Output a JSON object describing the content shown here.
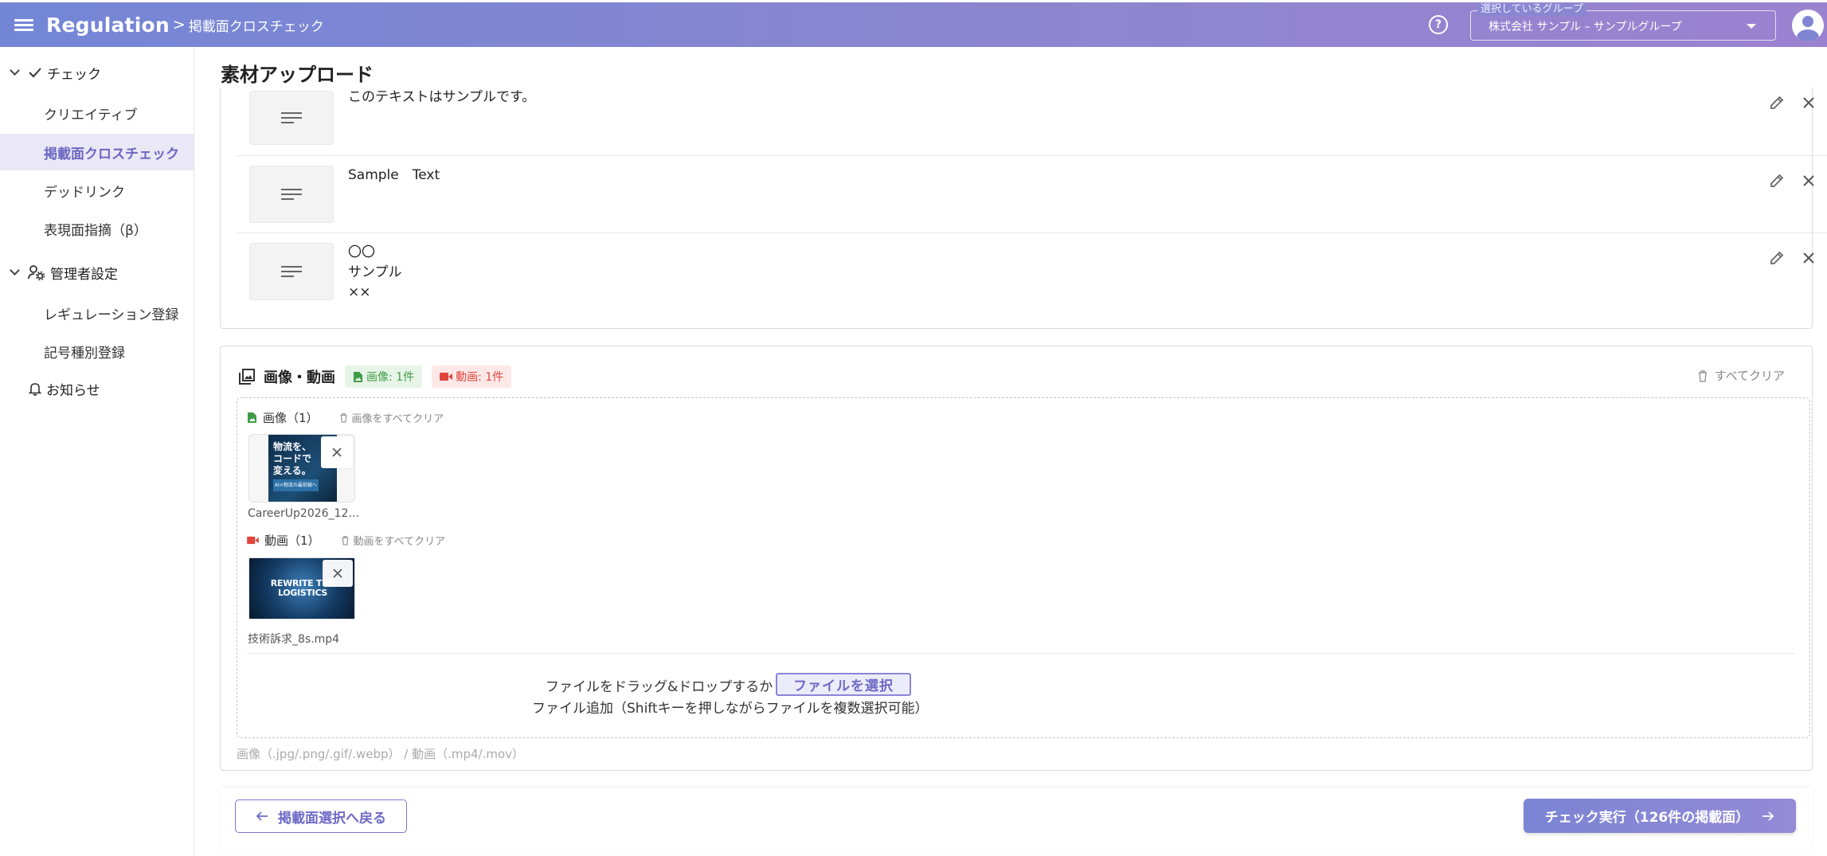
{
  "header": {
    "brand": "Regulation",
    "crumb_sep": ">",
    "crumb": "掲載面クロスチェック",
    "help_glyph": "?",
    "group_legend": "選択しているグループ",
    "group_value": "株式会社 サンプル – サンプルグループ"
  },
  "sidebar": {
    "check_group": "チェック",
    "check_items": [
      "クリエイティブ",
      "掲載面クロスチェック",
      "デッドリンク",
      "表現面指摘（β）"
    ],
    "active_item": "掲載面クロスチェック",
    "admin_group": "管理者設定",
    "admin_items": [
      "レギュレーション登録",
      "記号種別登録"
    ],
    "notice": "お知らせ"
  },
  "main": {
    "title": "素材アップロード",
    "text_rows": [
      {
        "text": "このテキストはサンプルです。"
      },
      {
        "text": "Sample　Text"
      },
      {
        "text": "〇〇\nサンプル\n××"
      }
    ],
    "media": {
      "title": "画像・動画",
      "image_badge": "画像: 1件",
      "video_badge": "動画: 1件",
      "clear_all": "すべてクリア",
      "image_head": "画像（1）",
      "image_clear": "画像をすべてクリア",
      "image_thumb_lines": [
        "物流を、",
        "コードで",
        "変える。"
      ],
      "image_thumb_sub": "AI×物流の最前線へ",
      "image_caption": "CareerUp2026_12…",
      "video_head": "動画（1）",
      "video_clear": "動画をすべてクリア",
      "video_thumb_lines": [
        "REWRITE THE",
        "LOGISTICS"
      ],
      "video_caption": "技術訴求_8s.mp4",
      "drop_text": "ファイルをドラッグ&ドロップするか",
      "choose_button": "ファイルを選択",
      "drop_text2": "ファイル追加（Shiftキーを押しながらファイルを複数選択可能）",
      "formats": "画像（.jpg/.png/.gif/.webp） / 動画（.mp4/.mov）"
    }
  },
  "footer": {
    "back_label": "掲載面選択へ戻る",
    "run_label": "チェック実行（126件の掲載面）"
  },
  "colors": {
    "accent": "#7f86d3",
    "image_green": "#3f9c45",
    "video_red": "#e0453c",
    "active_bg": "#eae8f6"
  }
}
